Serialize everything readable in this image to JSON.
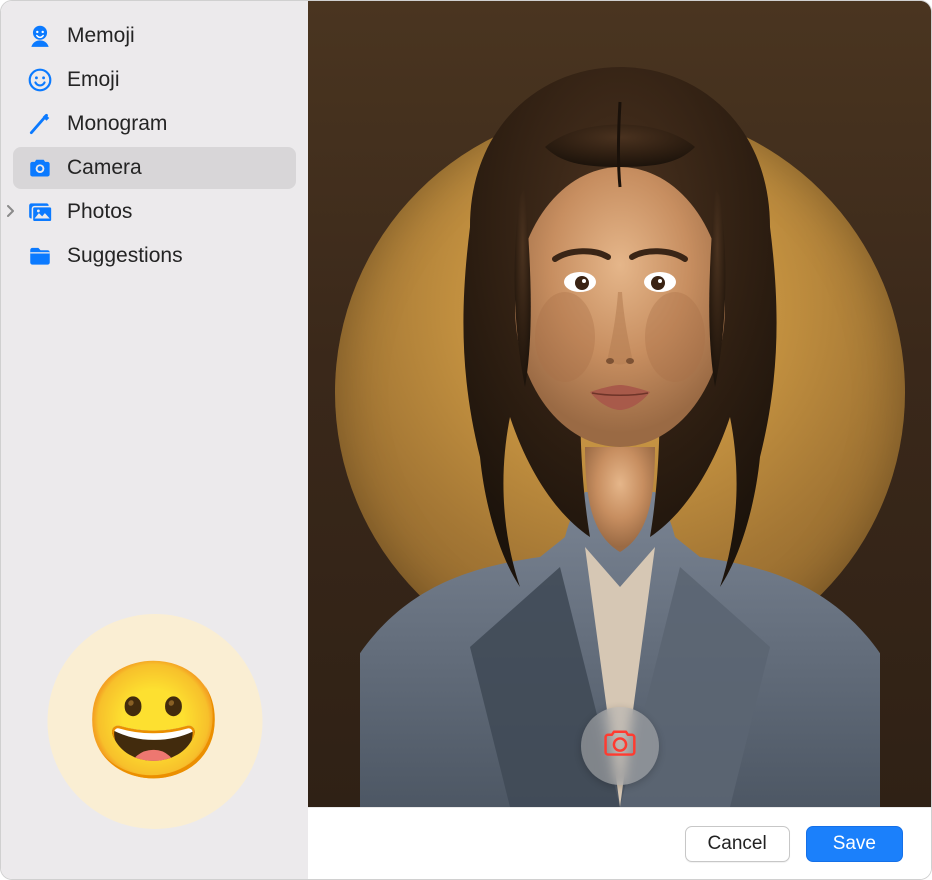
{
  "sidebar": {
    "items": [
      {
        "label": "Memoji",
        "icon": "memoji"
      },
      {
        "label": "Emoji",
        "icon": "emoji"
      },
      {
        "label": "Monogram",
        "icon": "monogram"
      },
      {
        "label": "Camera",
        "icon": "camera",
        "selected": true
      },
      {
        "label": "Photos",
        "icon": "photos",
        "disclosure": true
      },
      {
        "label": "Suggestions",
        "icon": "suggestions"
      }
    ]
  },
  "preview": {
    "emoji": "😀"
  },
  "footer": {
    "cancel_label": "Cancel",
    "save_label": "Save"
  },
  "colors": {
    "accent": "#1b80fb",
    "sidebar_bg": "#eceaec",
    "sidebar_selected": "#d8d6d8",
    "icon_blue": "#0b7aff"
  }
}
